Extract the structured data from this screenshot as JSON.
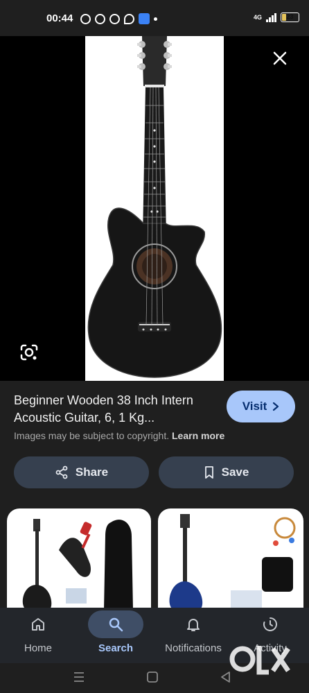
{
  "status_bar": {
    "time": "00:44",
    "battery": "23",
    "network": "4G"
  },
  "viewer": {
    "close_icon": "close-icon",
    "lens_icon": "google-lens-icon"
  },
  "result": {
    "title": "Beginner Wooden 38 Inch Intern Acoustic Guitar, 6, 1 Kg...",
    "visit_label": "Visit",
    "copyright_text": "Images may be subject to copyright.",
    "learn_more": "Learn more",
    "share_label": "Share",
    "save_label": "Save"
  },
  "bottom_nav": {
    "items": [
      {
        "label": "Home",
        "icon": "home-icon"
      },
      {
        "label": "Search",
        "icon": "search-icon"
      },
      {
        "label": "Notifications",
        "icon": "bell-icon"
      },
      {
        "label": "Activity",
        "icon": "activity-icon"
      }
    ]
  },
  "colors": {
    "accent": "#a8c7fa",
    "background": "#1f1f1f",
    "button": "#36404f"
  }
}
